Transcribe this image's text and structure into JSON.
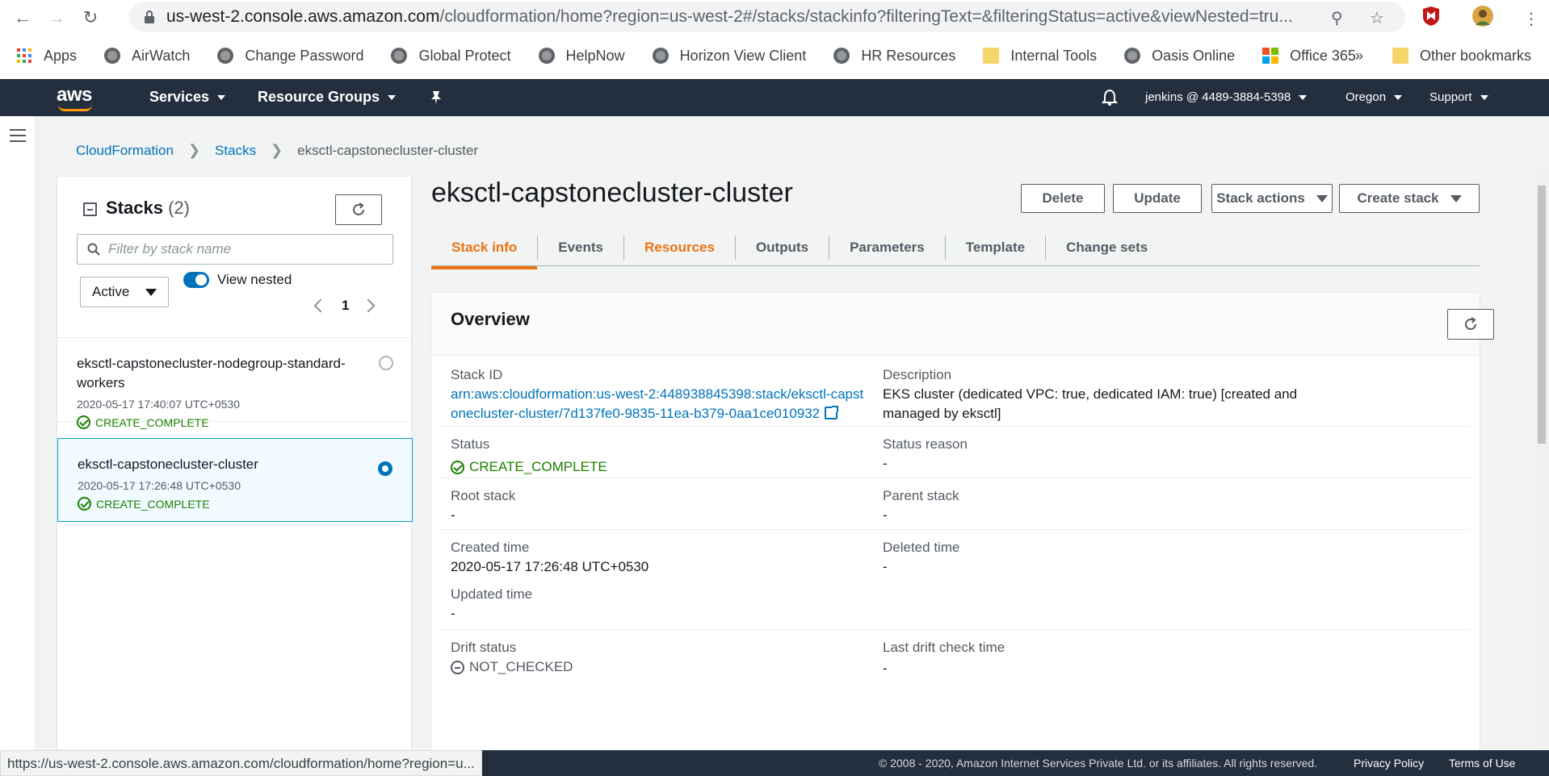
{
  "browser": {
    "url_host": "us-west-2.console.aws.amazon.com",
    "url_path": "/cloudformation/home?region=us-west-2#/stacks/stackinfo?filteringText=&filteringStatus=active&viewNested=tru...",
    "status_url": "https://us-west-2.console.aws.amazon.com/cloudformation/home?region=u...",
    "bookmarks": [
      "Apps",
      "AirWatch",
      "Change Password",
      "Global Protect",
      "HelpNow",
      "Horizon View Client",
      "HR Resources",
      "Internal Tools",
      "Oasis Online",
      "Office 365"
    ],
    "more_bookmarks": "»",
    "other_bookmarks": "Other bookmarks"
  },
  "aws_nav": {
    "logo": "aws",
    "services": "Services",
    "resource_groups": "Resource Groups",
    "account": "jenkins @ 4489-3884-5398",
    "region": "Oregon",
    "support": "Support"
  },
  "breadcrumb": {
    "root": "CloudFormation",
    "stacks": "Stacks",
    "current": "eksctl-capstonecluster-cluster"
  },
  "stacks_panel": {
    "title": "Stacks",
    "count": "(2)",
    "filter_placeholder": "Filter by stack name",
    "status_filter": "Active",
    "view_nested_label": "View nested",
    "view_nested_on": true,
    "page": "1",
    "items": [
      {
        "name": "eksctl-capstonecluster-nodegroup-standard-workers",
        "date": "2020-05-17 17:40:07 UTC+0530",
        "status": "CREATE_COMPLETE",
        "selected": false
      },
      {
        "name": "eksctl-capstonecluster-cluster",
        "date": "2020-05-17 17:26:48 UTC+0530",
        "status": "CREATE_COMPLETE",
        "selected": true
      }
    ]
  },
  "header": {
    "title": "eksctl-capstonecluster-cluster",
    "delete": "Delete",
    "update": "Update",
    "stack_actions": "Stack actions",
    "create_stack": "Create stack"
  },
  "tabs": [
    "Stack info",
    "Events",
    "Resources",
    "Outputs",
    "Parameters",
    "Template",
    "Change sets"
  ],
  "overview": {
    "title": "Overview",
    "stack_id_label": "Stack ID",
    "stack_id": "arn:aws:cloudformation:us-west-2:448938845398:stack/eksctl-capstonecluster-cluster/7d137fe0-9835-11ea-b379-0aa1ce010932",
    "description_label": "Description",
    "description": "EKS cluster (dedicated VPC: true, dedicated IAM: true) [created and managed by eksctl]",
    "status_label": "Status",
    "status": "CREATE_COMPLETE",
    "status_reason_label": "Status reason",
    "status_reason": "-",
    "root_stack_label": "Root stack",
    "root_stack": "-",
    "parent_stack_label": "Parent stack",
    "parent_stack": "-",
    "created_time_label": "Created time",
    "created_time": "2020-05-17 17:26:48 UTC+0530",
    "deleted_time_label": "Deleted time",
    "deleted_time": "-",
    "updated_time_label": "Updated time",
    "updated_time": "-",
    "drift_status_label": "Drift status",
    "drift_status": "NOT_CHECKED",
    "last_drift_label": "Last drift check time",
    "last_drift": "-"
  },
  "footer": {
    "copyright": "© 2008 - 2020, Amazon Internet Services Private Ltd. or its affiliates. All rights reserved.",
    "privacy": "Privacy Policy",
    "terms": "Terms of Use"
  },
  "colors": {
    "aws_nav": "#232f3e",
    "accent_orange": "#ec7211",
    "link_blue": "#0073bb",
    "success_green": "#1d8102"
  }
}
